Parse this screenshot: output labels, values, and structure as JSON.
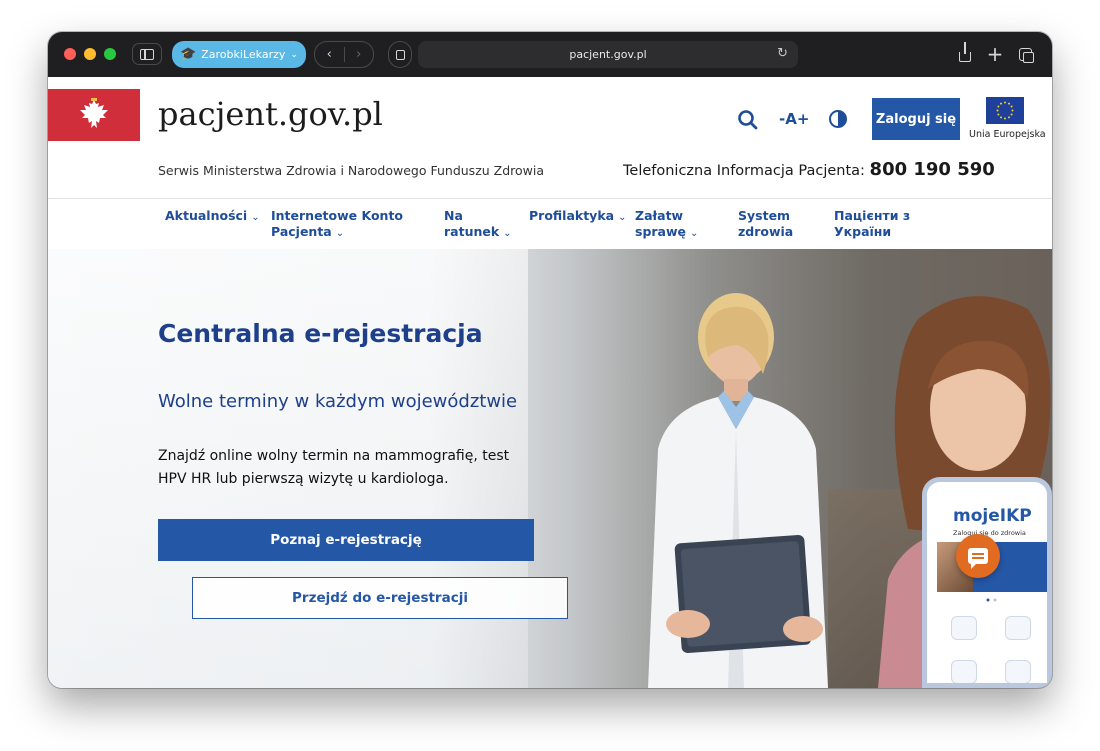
{
  "browser": {
    "profile_name": "ZarobkiLekarzy",
    "url": "pacjent.gov.pl"
  },
  "header": {
    "site_title": "pacjent.gov.pl",
    "subtitle": "Serwis Ministerstwa Zdrowia i Narodowego Funduszu Zdrowia",
    "phone_label": "Telefoniczna Informacja Pacjenta:",
    "phone_number": "800 190 590",
    "font_size_label": "-A+",
    "login_label": "Zaloguj się",
    "eu_label": "Unia Europejska"
  },
  "nav": {
    "items": [
      {
        "line1": "Aktualności",
        "line2": ""
      },
      {
        "line1": "Internetowe Konto",
        "line2": "Pacjenta"
      },
      {
        "line1": "Na",
        "line2": "ratunek"
      },
      {
        "line1": "Profilaktyka",
        "line2": ""
      },
      {
        "line1": "Załatw",
        "line2": "sprawę"
      },
      {
        "line1": "System",
        "line2": "zdrowia"
      },
      {
        "line1": "Пацієнти з",
        "line2": "України"
      }
    ]
  },
  "hero": {
    "title": "Centralna e-rejestracja",
    "subtitle": "Wolne terminy w każdym województwie",
    "text": "Znajdź online wolny termin na mammografię, test HPV HR lub pierwszą wizytę u kardiologa.",
    "primary_cta": "Poznaj e-rejestrację",
    "secondary_cta": "Przejdź do e-rejestracji"
  },
  "phone_app": {
    "logo": "mojeIKP",
    "tagline": "Zaloguj się do zdrowia"
  },
  "colors": {
    "brand_blue": "#2557a7",
    "heading_blue": "#1e3f8a",
    "gov_red": "#cf2e3a",
    "chat_orange": "#e06b21"
  }
}
